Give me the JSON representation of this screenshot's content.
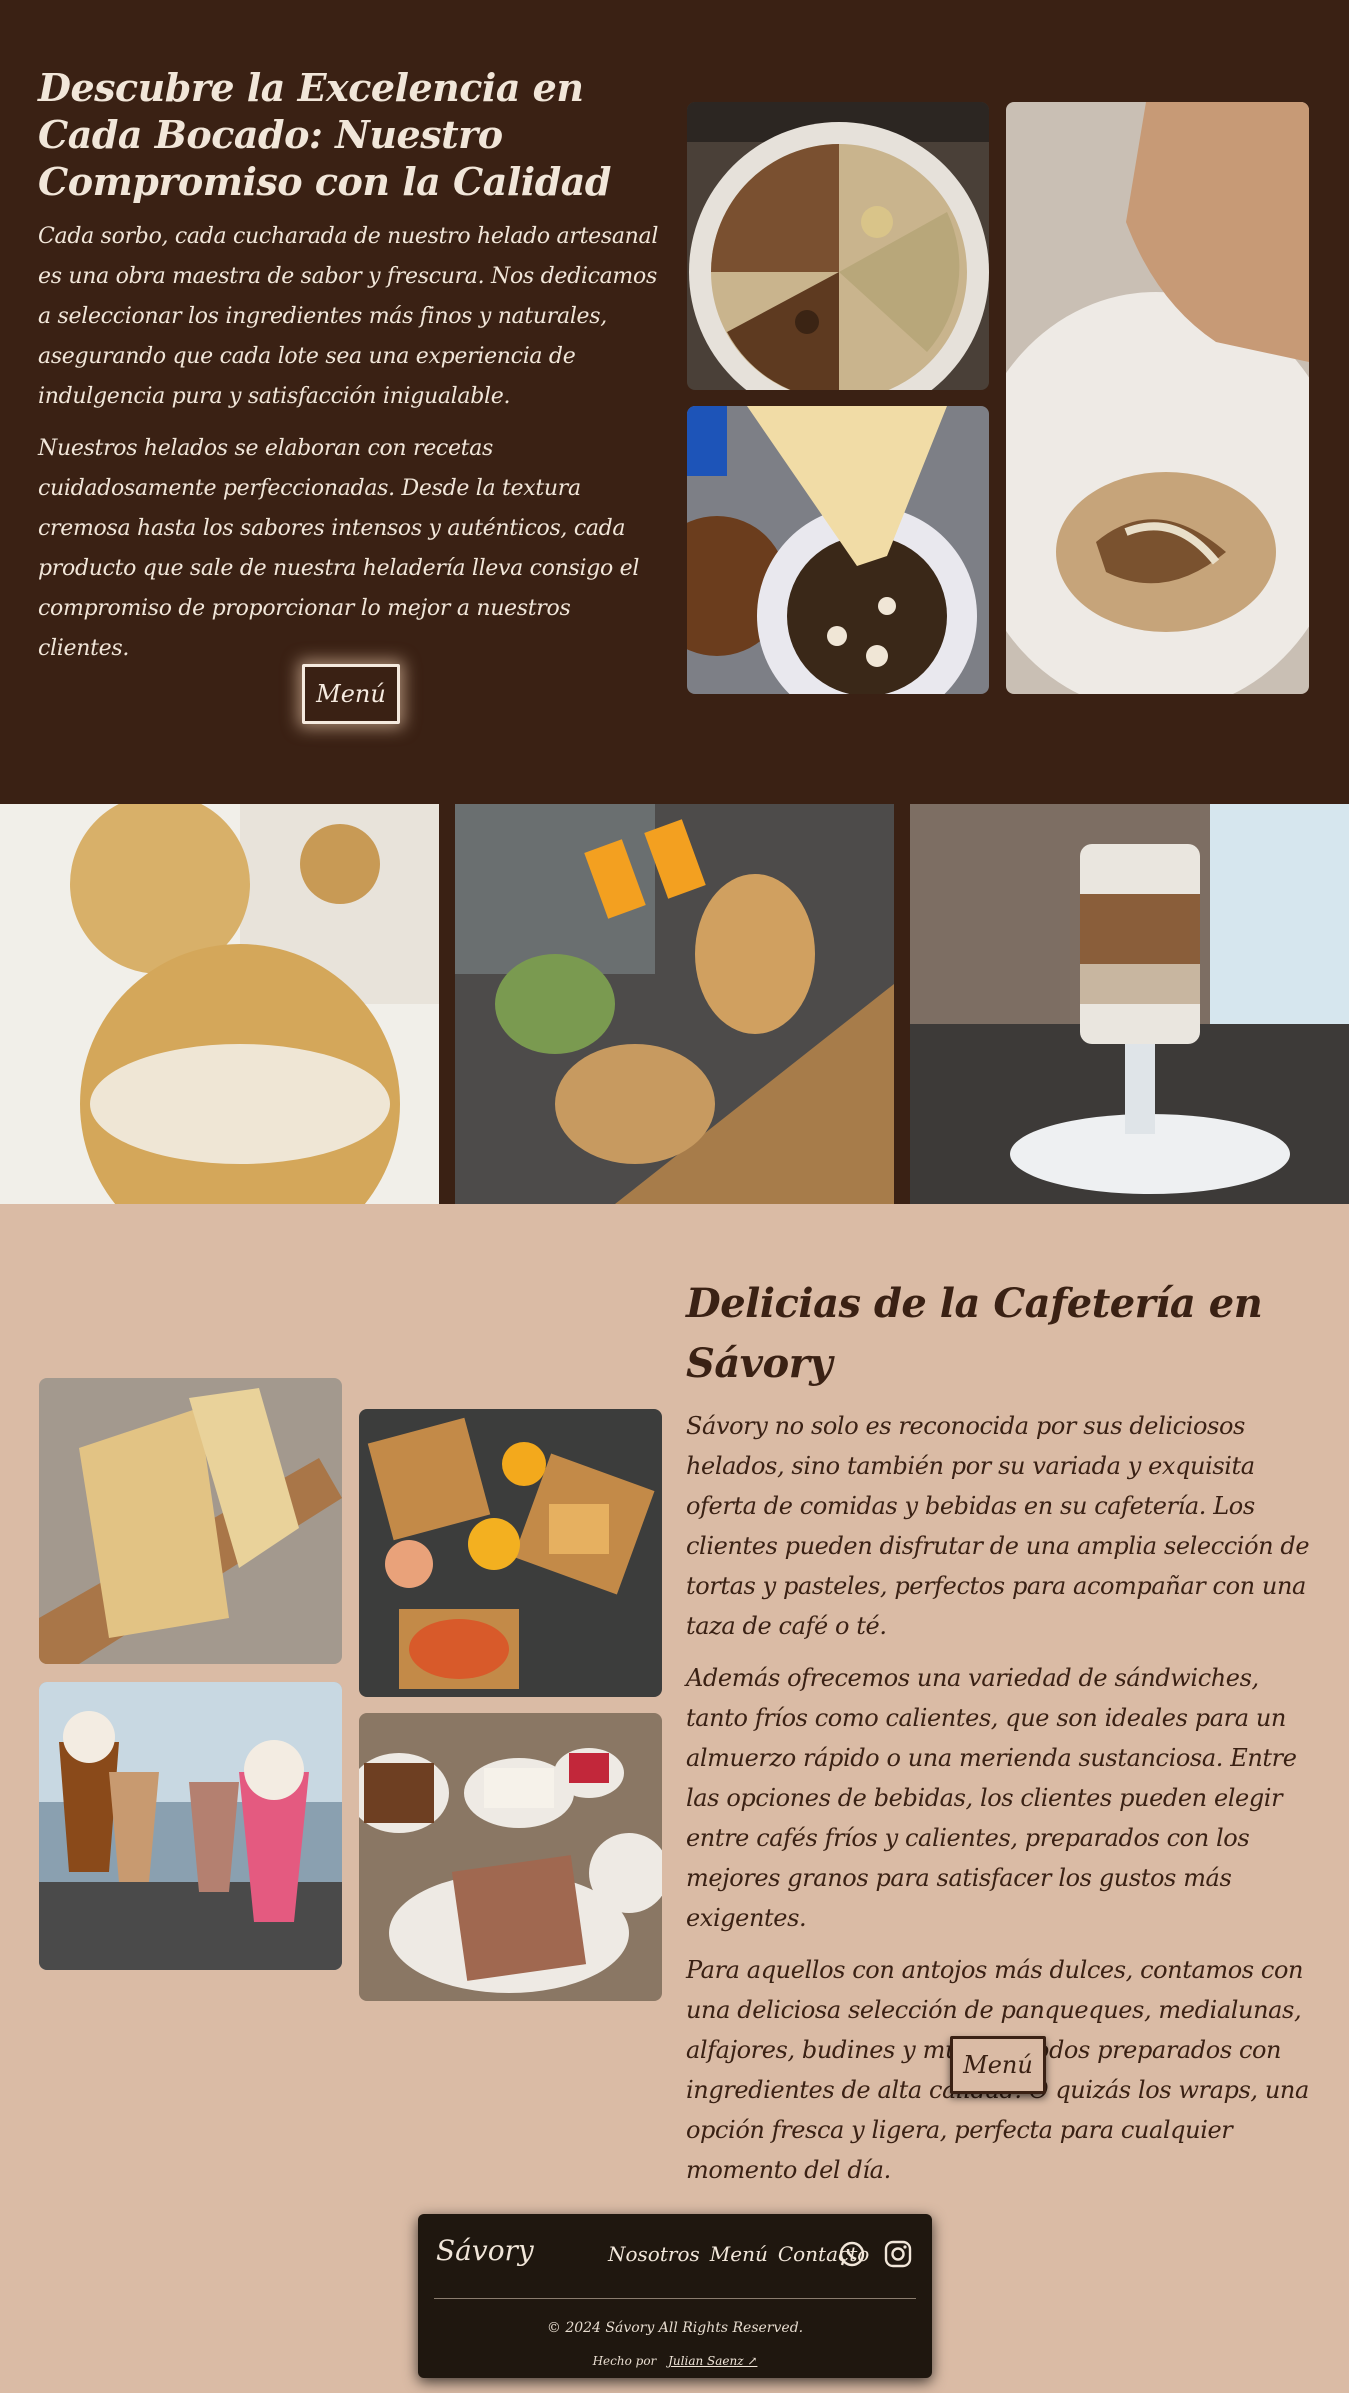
{
  "hero": {
    "title": "Descubre la Excelencia en Cada Bocado: Nuestro Compromiso con la Calidad",
    "paragraph_1": "Cada sorbo, cada cucharada de nuestro helado artesanal es una obra maestra de sabor y frescura. Nos dedicamos a seleccionar los ingredientes más finos y naturales, asegurando que cada lote sea una experiencia de indulgencia pura y satisfacción inigualable.",
    "paragraph_2": "Nuestros helados se elaboran con recetas cuidadosamente perfeccionadas. Desde la textura cremosa hasta los sabores intensos y auténticos, cada producto que sale de nuestra heladería lleva consigo el compromiso de proporcionar lo mejor a nuestros clientes.",
    "button_label": "Menú"
  },
  "cafe": {
    "title": "Delicias de la Cafetería en Sávory",
    "paragraph_1": "Sávory no solo es reconocida por sus deliciosos helados, sino también por su variada y exquisita oferta de comidas y bebidas en su cafetería. Los clientes pueden disfrutar de una amplia selección de tortas y pasteles, perfectos para acompañar con una taza de café o té.",
    "paragraph_2": "Además ofrecemos una variedad de sándwiches, tanto fríos como calientes, que son ideales para un almuerzo rápido o una merienda sustanciosa. Entre las opciones de bebidas, los clientes pueden elegir entre cafés fríos y calientes, preparados con los mejores granos para satisfacer los gustos más exigentes.",
    "paragraph_3": "Para aquellos con antojos más dulces, contamos con una deliciosa selección de panqueques, medialunas, alfajores, budines y muffins, todos preparados con ingredientes de alta calidad. O quizás los wraps, una opción fresca y ligera, perfecta para cualquier momento del día.",
    "button_label": "Menú"
  },
  "footer": {
    "brand": "Sávory",
    "nav": [
      "Nosotros",
      "Menú",
      "Contacto"
    ],
    "copyright": "© 2024 Sávory All Rights Reserved.",
    "made_by_prefix": "Hecho por",
    "made_by_name": "Julian Saenz ↗"
  },
  "colors": {
    "dark_brown": "#3a2114",
    "beige": "#dabba5",
    "cream": "#f1e6d9",
    "footer_bg": "#1f170f"
  },
  "icons": [
    "whatsapp-icon",
    "instagram-icon",
    "external-link-icon"
  ]
}
